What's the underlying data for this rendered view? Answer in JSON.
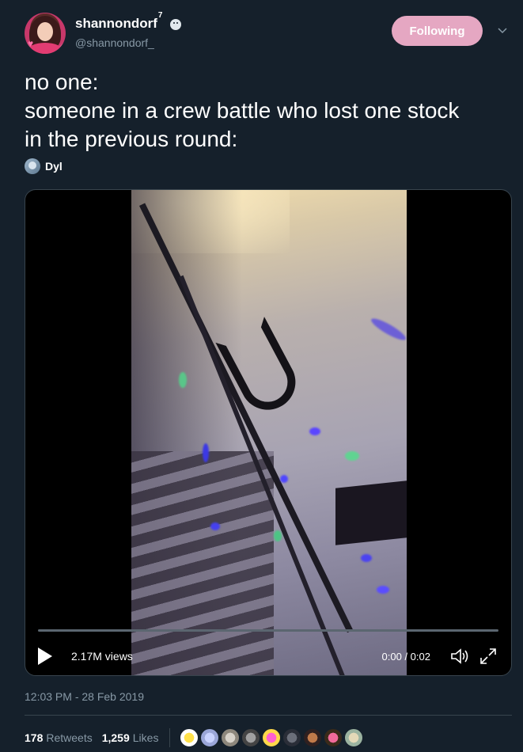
{
  "tweet": {
    "author": {
      "display_name": "shannondorf",
      "display_name_suffix": "7",
      "handle": "@shannondorf_",
      "avatar_icon": "profile-avatar"
    },
    "follow_button_label": "Following",
    "text": "no one:\nsomeone in a crew battle who lost one stock\nin the previous round:",
    "tagged_user": "Dyl",
    "video": {
      "views": "2.17M views",
      "time": "0:00 / 0:02",
      "progress": 0
    },
    "timestamp": "12:03 PM - 28 Feb 2019",
    "stats": {
      "retweets_count": "178",
      "retweets_label": "Retweets",
      "likes_count": "1,259",
      "likes_label": "Likes"
    }
  },
  "colors": {
    "background": "#15202b",
    "following_button": "#e5a7c2",
    "secondary_text": "#8899a6",
    "divider": "#38444d"
  }
}
